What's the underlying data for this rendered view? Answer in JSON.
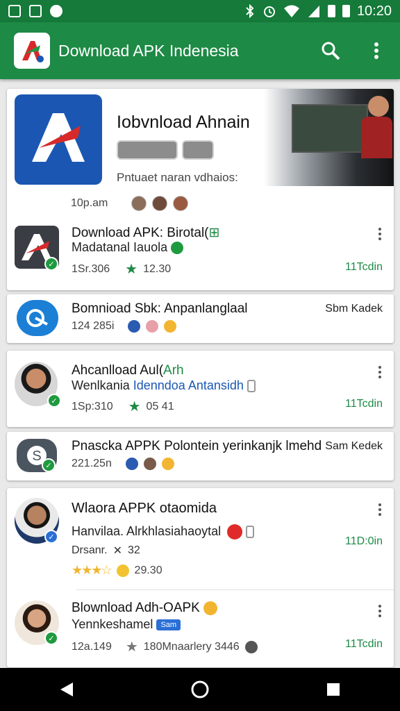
{
  "status_bar": {
    "time": "10:20",
    "left_icons": [
      "image-icon",
      "photo-icon",
      "shield-icon"
    ],
    "right_icons": [
      "bluetooth-icon",
      "alarm-icon",
      "wifi-icon",
      "signal-icon",
      "battery-icon",
      "battery-icon"
    ]
  },
  "app_bar": {
    "title": "Download APK  Indenesia",
    "search_icon": "search-icon",
    "menu_icon": "more-vert-icon"
  },
  "colors": {
    "primary": "#1d8a45",
    "status_bar": "#157a3a",
    "icon_blue": "#1b57b2",
    "icon_red": "#d62a2a"
  },
  "featured": {
    "title": "Iobvnload Ahnain",
    "subtitle": "Pntuaet naran vdhaios:",
    "meta": "10p.am"
  },
  "apps": [
    {
      "title": "Download APK: Birotal(",
      "title_icon": "android-icon",
      "subtitle": "Madatanal Iauola",
      "meta": "1Sr.306",
      "rating": "12.30",
      "price": "11Tcdin"
    },
    {
      "title": "Bomnioad Sbk: Anpanlanglaal",
      "subtitle": "124 285i",
      "price": "Sbm Kadek"
    },
    {
      "title": "Ahcanlload Aul(",
      "title_green": "Arh",
      "subtitle_dark": "Wenlkania",
      "subtitle_blue": "Idenndoa  Antansidh",
      "meta": "1Sp:310",
      "rating": "05 41",
      "price": "11Tcdin"
    },
    {
      "title": "Pnascka APPK  Polontein yerinkanjk lmehd",
      "subtitle": "221.25n",
      "price": "Sam Kedek"
    },
    {
      "title": "Wlaora APPK otaomida",
      "subtitle": "Hanvilaa.  Alrkhlasiahaoytal",
      "meta_label": "Drsanr.",
      "meta_value": "32",
      "rating": "29.30",
      "price": "11D:0in"
    },
    {
      "title": "Blownload Adh-OAPK",
      "subtitle": "Yennkeshamel",
      "tag": "Sam",
      "meta": "12a.149",
      "meta_detail": "180Mnaarlery 3446",
      "price": "11Tcdin"
    }
  ]
}
